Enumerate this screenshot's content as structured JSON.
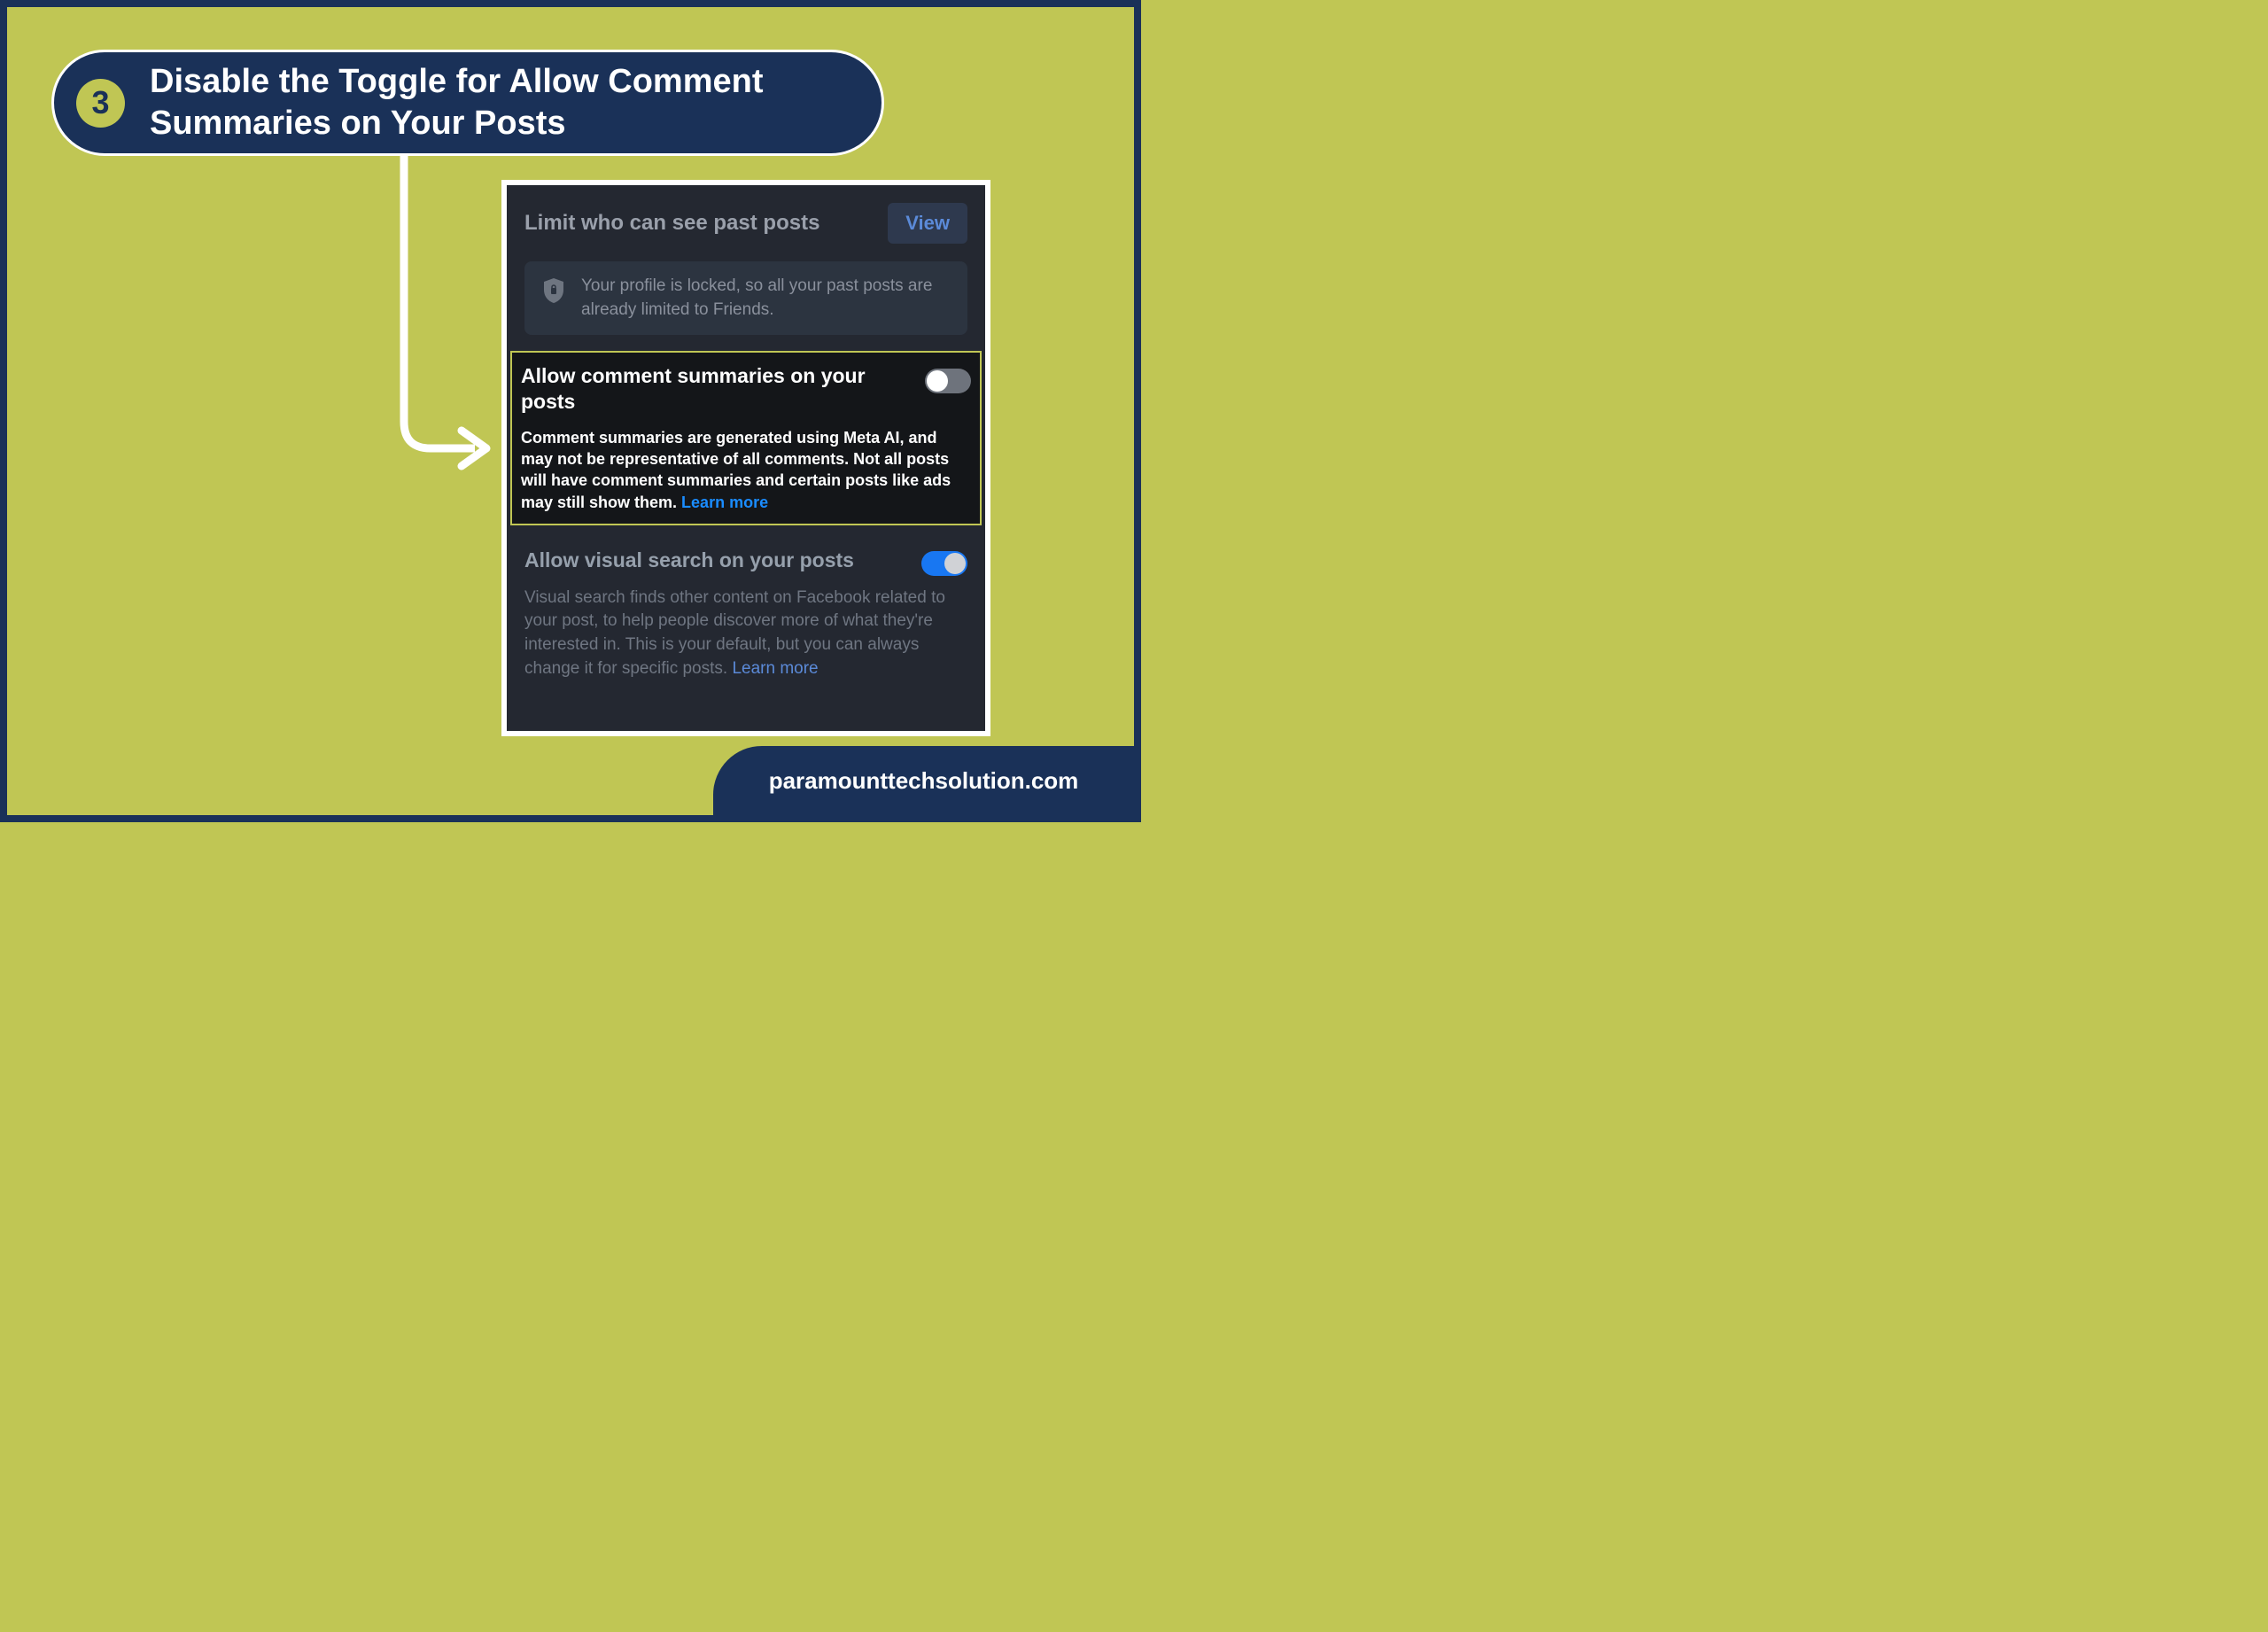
{
  "header": {
    "step_number": "3",
    "title": "Disable the Toggle for Allow Comment Summaries on Your Posts"
  },
  "panel": {
    "limit_section": {
      "title": "Limit who can see past posts",
      "view_label": "View",
      "info_text": "Your profile is locked, so all your past posts are already limited to Friends."
    },
    "comment_summaries": {
      "title": "Allow comment summaries on your posts",
      "description": "Comment summaries are generated using Meta AI, and may not be representative of all comments. Not all posts will have comment summaries and certain posts like ads may still show them. ",
      "learn_more": "Learn more",
      "toggle_state": "off"
    },
    "visual_search": {
      "title": "Allow visual search on your posts",
      "description": "Visual search finds other content on Facebook related to your post, to help people discover more of what they're interested in. This is your default, but you can always change it for specific posts. ",
      "learn_more": "Learn more",
      "toggle_state": "on"
    }
  },
  "footer": {
    "text": "paramounttechsolution.com"
  }
}
